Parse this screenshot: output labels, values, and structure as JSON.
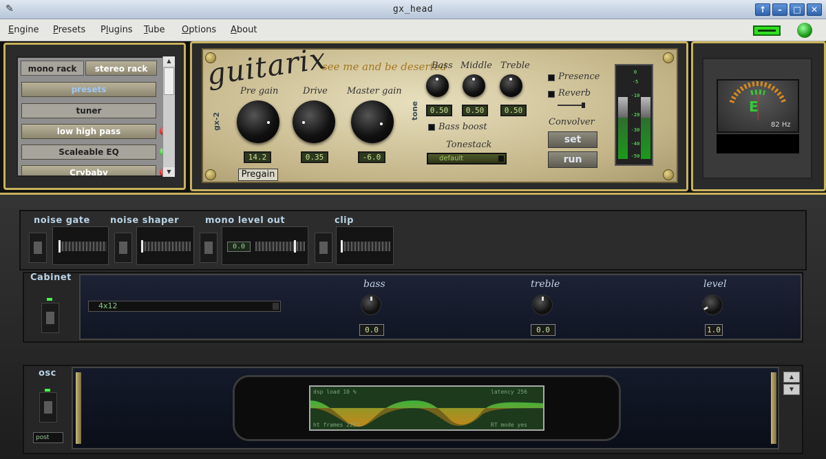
{
  "window": {
    "title": "gx_head"
  },
  "menu": [
    {
      "label": "Engine",
      "key": "E"
    },
    {
      "label": "Presets",
      "key": "P"
    },
    {
      "label": "Plugins",
      "key": "l"
    },
    {
      "label": "Tube",
      "key": "T"
    },
    {
      "label": "Options",
      "key": "O"
    },
    {
      "label": "About",
      "key": "A"
    }
  ],
  "rack": {
    "tabs": [
      "mono rack",
      "stereo rack"
    ],
    "items": [
      {
        "label": "presets",
        "led": null
      },
      {
        "label": "tuner",
        "led": null
      },
      {
        "label": "low high pass",
        "led": "#e01010"
      },
      {
        "label": "Scaleable EQ",
        "led": "#20d020"
      },
      {
        "label": "Crybaby",
        "led": "#e01010"
      }
    ]
  },
  "amp": {
    "logo": "guitarix",
    "slogan": "see me and be deserted",
    "model": "gx-2",
    "tone_label": "tone",
    "knobs": [
      {
        "label": "Pre gain",
        "value": "14.2"
      },
      {
        "label": "Drive",
        "value": "0.35"
      },
      {
        "label": "Master gain",
        "value": "-6.0"
      }
    ],
    "tone_knobs": [
      {
        "label": "Bass",
        "value": "0.50"
      },
      {
        "label": "Middle",
        "value": "0.50"
      },
      {
        "label": "Treble",
        "value": "0.50"
      }
    ],
    "bass_boost": "Bass boost",
    "tonestack_label": "Tonestack",
    "tonestack_value": "default",
    "presence": "Presence",
    "reverb": "Reverb",
    "convolver_label": "Convolver",
    "set_button": "set",
    "run_button": "run",
    "tooltip": "Pregain",
    "meter_ticks": [
      "0",
      "-5",
      "-10",
      "-20",
      "-30",
      "-40",
      "-50"
    ]
  },
  "tuner": {
    "note": "E",
    "frequency": "82 Hz"
  },
  "mono_units": [
    {
      "label": "noise gate"
    },
    {
      "label": "noise shaper"
    },
    {
      "label": "mono level out",
      "value": "0.0"
    },
    {
      "label": "clip"
    }
  ],
  "cabinet": {
    "label": "Cabinet",
    "model": "4x12",
    "knobs": [
      {
        "label": "bass",
        "value": "0.0"
      },
      {
        "label": "treble",
        "value": "0.0"
      },
      {
        "label": "level",
        "value": "1.0"
      }
    ]
  },
  "osc": {
    "label": "osc",
    "mode": "post",
    "dsp_load": "dsp load  10 %",
    "latency": "latency   256",
    "frames": "ht frames  2251",
    "rt_mode": "RT mode yes"
  },
  "colors": {
    "accent_gold": "#c9b35e",
    "led_green": "#33dd22",
    "led_red": "#e01010",
    "wave_green": "#40c040"
  }
}
